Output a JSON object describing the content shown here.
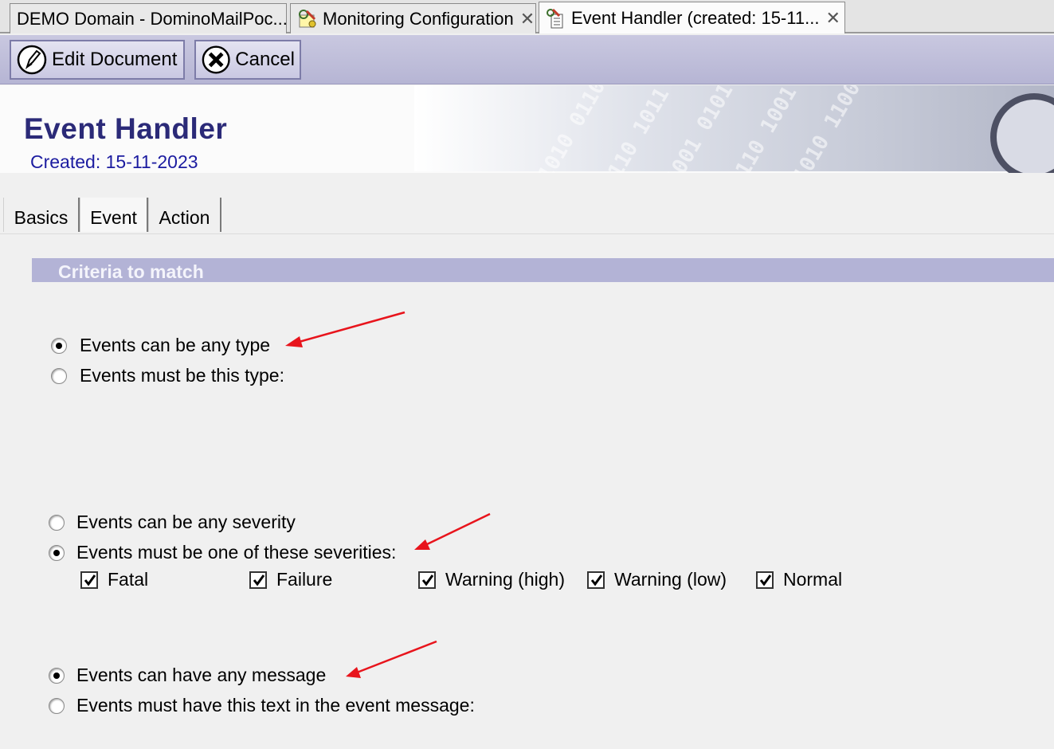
{
  "window_tabs": [
    {
      "label": "DEMO Domain - DominoMailPoc...",
      "closable": false,
      "active": false
    },
    {
      "label": "Monitoring Configuration",
      "closable": true,
      "active": false
    },
    {
      "label": "Event Handler (created: 15-11...",
      "closable": true,
      "active": true
    }
  ],
  "actions": {
    "edit_label": "Edit Document",
    "cancel_label": "Cancel"
  },
  "header": {
    "title": "Event Handler",
    "subtitle": "Created: 15-11-2023"
  },
  "form_tabs": [
    "Basics",
    "Event",
    "Action"
  ],
  "section": {
    "title": "Criteria to match"
  },
  "type_options": [
    {
      "label": "Events can be any type",
      "selected": true
    },
    {
      "label": "Events must be this type:",
      "selected": false
    }
  ],
  "severity_options": [
    {
      "label": "Events can be any severity",
      "selected": false
    },
    {
      "label": "Events must be one of these severities:",
      "selected": true
    }
  ],
  "severities": [
    {
      "label": "Fatal",
      "checked": true
    },
    {
      "label": "Failure",
      "checked": true
    },
    {
      "label": "Warning (high)",
      "checked": true
    },
    {
      "label": "Warning (low)",
      "checked": true
    },
    {
      "label": "Normal",
      "checked": true
    }
  ],
  "message_options": [
    {
      "label": "Events can have any message",
      "selected": true
    },
    {
      "label": "Events must have this text in the event message:",
      "selected": false
    }
  ],
  "colors": {
    "action_bar": "#b6b5d4",
    "title": "#2b2a78",
    "section_bar": "#b3b3d6",
    "annotation_arrow": "#e8141c"
  }
}
